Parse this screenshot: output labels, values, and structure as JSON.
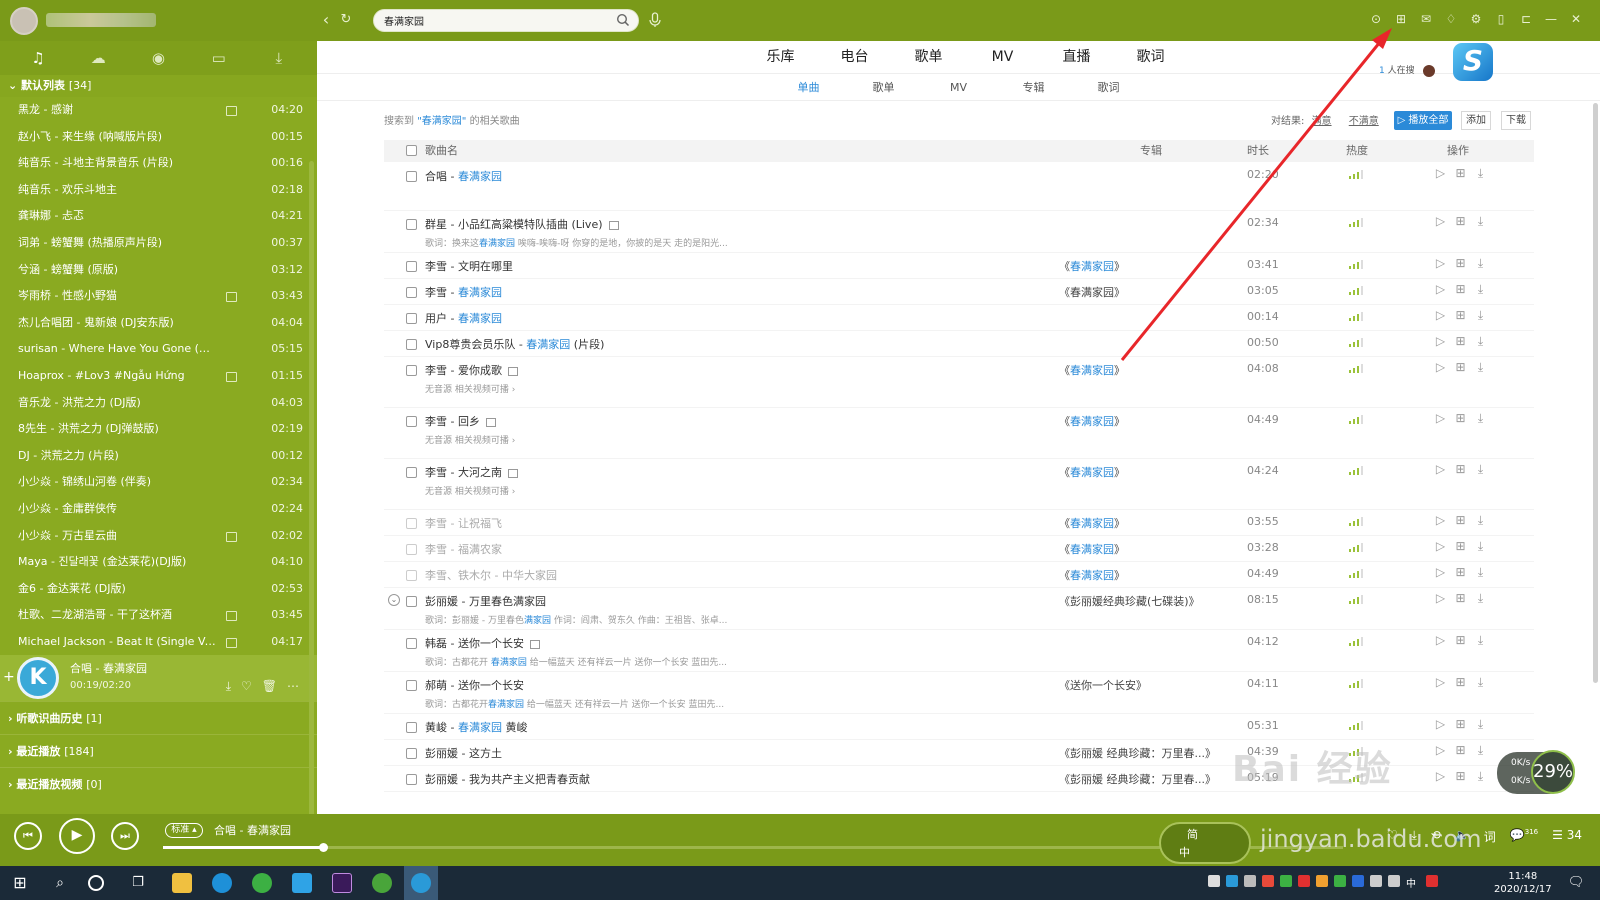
{
  "search": {
    "value": "春满家园"
  },
  "sidebar": {
    "list_title": "默认列表",
    "list_count": "[34]",
    "songs": [
      {
        "title": "黑龙 - 感谢",
        "dur": "04:20",
        "mv": true
      },
      {
        "title": "赵小飞 - 来生缘 (呐喊版片段)",
        "dur": "00:15",
        "mv": false
      },
      {
        "title": "纯音乐 - 斗地主背景音乐 (片段)",
        "dur": "00:16",
        "mv": false
      },
      {
        "title": "纯音乐 - 欢乐斗地主",
        "dur": "02:18",
        "mv": false
      },
      {
        "title": "龚琳娜 - 忐忑",
        "dur": "04:21",
        "mv": false
      },
      {
        "title": "词弟 - 螃蟹舞 (热播原声片段)",
        "dur": "00:37",
        "mv": false
      },
      {
        "title": "兮涵 - 螃蟹舞 (原版)",
        "dur": "03:12",
        "mv": false
      },
      {
        "title": "岑雨桥 - 性感小野猫",
        "dur": "03:43",
        "mv": true
      },
      {
        "title": "杰儿合唱团 - 鬼新娘 (DJ安东版)",
        "dur": "04:04",
        "mv": false
      },
      {
        "title": "surisan - Where Have You Gone (DJ版)",
        "dur": "05:15",
        "mv": false
      },
      {
        "title": "Hoaprox - #Lov3 #Ngẫu Hứng",
        "dur": "01:15",
        "mv": true
      },
      {
        "title": "音乐龙 - 洪荒之力 (DJ版)",
        "dur": "04:03",
        "mv": false
      },
      {
        "title": "8先生 - 洪荒之力 (DJ弹鼓版)",
        "dur": "02:19",
        "mv": false
      },
      {
        "title": "DJ - 洪荒之力 (片段)",
        "dur": "00:12",
        "mv": false
      },
      {
        "title": "小少焱 - 锦绣山河卷 (伴奏)",
        "dur": "02:34",
        "mv": false
      },
      {
        "title": "小少焱 - 金庸群侠传",
        "dur": "02:24",
        "mv": false
      },
      {
        "title": "小少焱 - 万古星云曲",
        "dur": "02:02",
        "mv": true
      },
      {
        "title": "Maya - 진달래꽃 (金达莱花)(DJ版)",
        "dur": "04:10",
        "mv": false
      },
      {
        "title": "金6 - 金达莱花 (DJ版)",
        "dur": "02:53",
        "mv": false
      },
      {
        "title": "杜歌、二龙湖浩哥 - 干了这杯酒",
        "dur": "03:45",
        "mv": true
      },
      {
        "title": "Michael Jackson - Beat It (Single Ver...",
        "dur": "04:17",
        "mv": true
      }
    ],
    "now_playing": {
      "title": "合唱 - 春满家园",
      "time": "00:19/02:20",
      "cover_letter": "K"
    },
    "groups": [
      {
        "label": "听歌识曲历史",
        "count": "[1]"
      },
      {
        "label": "最近播放",
        "count": "[184]"
      },
      {
        "label": "最近播放视频",
        "count": "[0]"
      }
    ]
  },
  "main": {
    "top_tabs": [
      "乐库",
      "电台",
      "歌单",
      "MV",
      "直播",
      "歌词"
    ],
    "sub_tabs": [
      "单曲",
      "歌单",
      "MV",
      "专辑",
      "歌词"
    ],
    "result_prefix": "搜索到",
    "result_keyword": "\"春满家园\"",
    "result_suffix": "的相关歌曲",
    "feedback_label": "对结果:",
    "feedback_ok": "满意",
    "feedback_bad": "不满意",
    "play_all": "▷ 播放全部",
    "add": "添加",
    "download": "下载",
    "col_name": "歌曲名",
    "col_album": "专辑",
    "col_time": "时长",
    "col_heat": "热度",
    "col_ops": "操作",
    "trend_count": "1",
    "trend_text": "人在搜",
    "no_source": "无音源",
    "related_video": "相关视频可播 ›"
  },
  "results": [
    {
      "pre": "合唱 - ",
      "hl": "春满家园",
      "post": "",
      "album": "",
      "time": "02:20",
      "sub": "",
      "grey": false
    },
    {
      "pre": "群星 - 小品红高粱模特队插曲 (Live)",
      "hl": "",
      "post": "",
      "mv": true,
      "album": "",
      "time": "02:34",
      "sub_pre": "歌词：换来这",
      "sub_hl": "春满家园",
      "sub_post": " 唉嗨-唉嗨-呀 你穿的是地，你披的是天 走的是阳光...",
      "grey": false
    },
    {
      "pre": "李雪 - 文明在哪里",
      "hl": "",
      "post": "",
      "album_hl": "春满家园",
      "time": "03:41",
      "grey": false
    },
    {
      "pre": "李雪 - ",
      "hl": "春满家园",
      "post": "",
      "album_plain": "《春满家园》",
      "time": "03:05",
      "grey": false
    },
    {
      "pre": "用户 - ",
      "hl": "春满家园",
      "post": "",
      "album": "",
      "time": "00:14",
      "grey": false
    },
    {
      "pre": "Vip8尊贵会员乐队 - ",
      "hl": "春满家园",
      "post": " (片段)",
      "album": "",
      "time": "00:50",
      "grey": false
    },
    {
      "pre": "李雪 - 爱你成歌",
      "hl": "",
      "post": "",
      "mv": true,
      "album_hl": "春满家园",
      "time": "04:08",
      "nosrc": true,
      "grey": false
    },
    {
      "pre": "李雪 - 回乡",
      "hl": "",
      "post": "",
      "mv": true,
      "album_hl": "春满家园",
      "time": "04:49",
      "nosrc": true,
      "grey": false
    },
    {
      "pre": "李雪 - 大河之南",
      "hl": "",
      "post": "",
      "mv": true,
      "album_hl": "春满家园",
      "time": "04:24",
      "nosrc": true,
      "grey": false
    },
    {
      "pre": "李雪 - 让祝福飞",
      "hl": "",
      "post": "",
      "album_hl": "春满家园",
      "time": "03:55",
      "grey": true
    },
    {
      "pre": "李雪 - 福满农家",
      "hl": "",
      "post": "",
      "album_hl": "春满家园",
      "time": "03:28",
      "grey": true
    },
    {
      "pre": "李雪、铁木尔 - 中华大家园",
      "hl": "",
      "post": "",
      "album_hl": "春满家园",
      "time": "04:49",
      "grey": true
    },
    {
      "pre": "彭丽媛 - 万里春色满家园",
      "hl": "",
      "post": "",
      "album_plain": "《彭丽媛经典珍藏(七碟装)》",
      "time": "08:15",
      "sub_pre": "歌词：彭丽媛 - 万里春色",
      "sub_hl": "满家园",
      "sub_post": " 作词：阎肃、贺东久 作曲：王祖皆、张卓...",
      "expander": true,
      "grey": false
    },
    {
      "pre": "韩磊 - 送你一个长安",
      "hl": "",
      "post": "",
      "mv": true,
      "album": "",
      "time": "04:12",
      "sub_pre": "歌词：古都花开 ",
      "sub_hl": "春满家园",
      "sub_post": " 给一幅蓝天 还有祥云一片 送你一个长安 蓝田先...",
      "grey": false
    },
    {
      "pre": "郝萌 - 送你一个长安",
      "hl": "",
      "post": "",
      "album_plain": "《送你一个长安》",
      "time": "04:11",
      "sub_pre": "歌词：古都花开",
      "sub_hl": "春满家园",
      "sub_post": " 给一幅蓝天 还有祥云一片 送你一个长安 蓝田先...",
      "grey": false
    },
    {
      "pre": "黄峻 - ",
      "hl": "春满家园",
      "post": " 黄峻",
      "album": "",
      "time": "05:31",
      "grey": false
    },
    {
      "pre": "彭丽媛 - 这方土",
      "hl": "",
      "post": "",
      "album_plain": "《彭丽媛 经典珍藏：万里春...》",
      "time": "04:39",
      "grey": false
    },
    {
      "pre": "彭丽媛 - 我为共产主义把青春贡献",
      "hl": "",
      "post": "",
      "album_plain": "《彭丽媛 经典珍藏：万里春...》",
      "time": "05:19",
      "grey": false
    }
  ],
  "player": {
    "quality": "标准 ▴",
    "title": "合唱 - 春满家园",
    "progress": 0.136,
    "buffer": 0.47,
    "comments": "316",
    "list_count": "34"
  },
  "overlay": {
    "ime_top": "简",
    "ime_bottom": "中",
    "net_up": "0K/s",
    "net_down": "0K/s",
    "net_percent": "29%",
    "watermark": "Bai 经验",
    "watermark_url": "jingyan.baidu.com"
  },
  "taskbar": {
    "time": "11:48",
    "date": "2020/12/17",
    "ime": "中"
  },
  "colors": {
    "accent_green": "#7a9a19",
    "link_blue": "#2b8ad8",
    "annotation_red": "#e8262a"
  }
}
